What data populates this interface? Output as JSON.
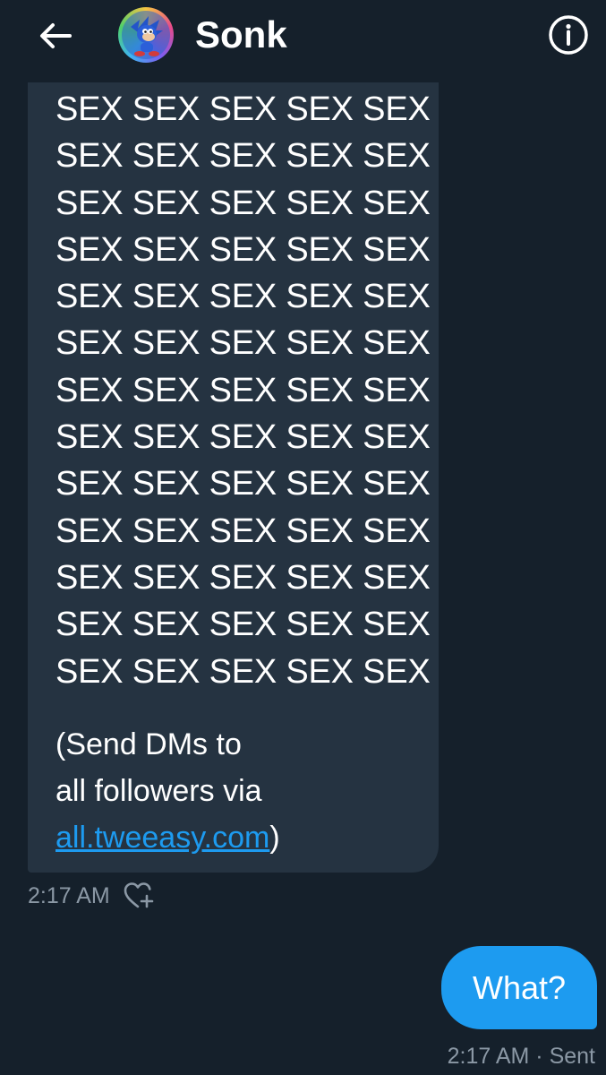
{
  "header": {
    "back_icon": "arrow-left-icon",
    "contact_name": "Sonk",
    "info_icon": "info-circle-icon"
  },
  "received_message": {
    "lines": [
      "SEX SEX SEX SEX SEX",
      "SEX SEX SEX SEX SEX",
      "SEX SEX SEX SEX SEX",
      "SEX SEX SEX SEX SEX",
      "SEX SEX SEX SEX SEX",
      "SEX SEX SEX SEX SEX",
      "SEX SEX SEX SEX SEX",
      "SEX SEX SEX SEX SEX",
      "SEX SEX SEX SEX SEX",
      "SEX SEX SEX SEX SEX",
      "SEX SEX SEX SEX SEX",
      "SEX SEX SEX SEX SEX",
      "SEX SEX SEX SEX SEX"
    ],
    "footer_line1": "(Send DMs to",
    "footer_line2": "all followers via",
    "link_text": "all.tweeasy.com",
    "footer_close": ")",
    "time": "2:17 AM",
    "react_icon": "heart-plus-icon"
  },
  "sent_message": {
    "text": "What?",
    "status": "2:17 AM · Sent"
  },
  "colors": {
    "background": "#15202b",
    "received_bubble": "#253341",
    "sent_bubble": "#1d9bf0",
    "link": "#1d9bf0",
    "meta_text": "#8b98a5"
  }
}
